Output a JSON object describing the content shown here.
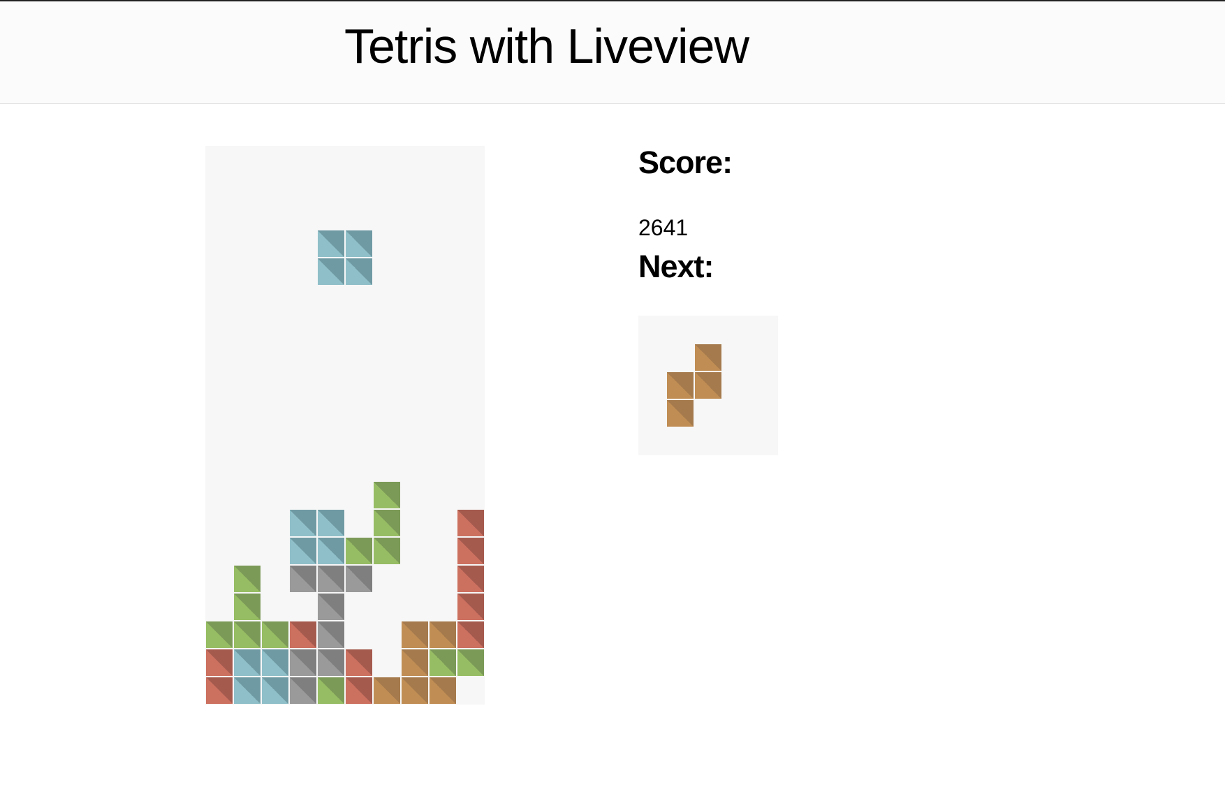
{
  "header": {
    "title": "Tetris with Liveview"
  },
  "sidebar": {
    "score_label": "Score:",
    "score_value": "2641",
    "next_label": "Next:"
  },
  "colors": {
    "blue": [
      "#8fbfc8",
      "#6f9aa3"
    ],
    "green": [
      "#97bd64",
      "#7b9a57"
    ],
    "red": [
      "#cc7060",
      "#a55a4e"
    ],
    "gray": [
      "#9a9a9a",
      "#7f7f7f"
    ],
    "orange": [
      "#c08d54",
      "#a57a4c"
    ],
    "board_bg": "#f7f7f7"
  },
  "board": {
    "columns": 10,
    "rows": 20,
    "active_piece": {
      "shape": "O",
      "color": "blue",
      "cells": [
        [
          4,
          3
        ],
        [
          5,
          3
        ],
        [
          4,
          4
        ],
        [
          5,
          4
        ]
      ]
    },
    "settled_cells": [
      {
        "col": 6,
        "row": 12,
        "color": "green"
      },
      {
        "col": 3,
        "row": 13,
        "color": "blue"
      },
      {
        "col": 4,
        "row": 13,
        "color": "blue"
      },
      {
        "col": 6,
        "row": 13,
        "color": "green"
      },
      {
        "col": 9,
        "row": 13,
        "color": "red"
      },
      {
        "col": 3,
        "row": 14,
        "color": "blue"
      },
      {
        "col": 4,
        "row": 14,
        "color": "blue"
      },
      {
        "col": 5,
        "row": 14,
        "color": "green"
      },
      {
        "col": 6,
        "row": 14,
        "color": "green"
      },
      {
        "col": 9,
        "row": 14,
        "color": "red"
      },
      {
        "col": 1,
        "row": 15,
        "color": "green"
      },
      {
        "col": 3,
        "row": 15,
        "color": "gray"
      },
      {
        "col": 4,
        "row": 15,
        "color": "gray"
      },
      {
        "col": 5,
        "row": 15,
        "color": "gray"
      },
      {
        "col": 9,
        "row": 15,
        "color": "red"
      },
      {
        "col": 1,
        "row": 16,
        "color": "green"
      },
      {
        "col": 4,
        "row": 16,
        "color": "gray"
      },
      {
        "col": 9,
        "row": 16,
        "color": "red"
      },
      {
        "col": 0,
        "row": 17,
        "color": "green"
      },
      {
        "col": 1,
        "row": 17,
        "color": "green"
      },
      {
        "col": 2,
        "row": 17,
        "color": "green"
      },
      {
        "col": 3,
        "row": 17,
        "color": "red"
      },
      {
        "col": 4,
        "row": 17,
        "color": "gray"
      },
      {
        "col": 7,
        "row": 17,
        "color": "orange"
      },
      {
        "col": 8,
        "row": 17,
        "color": "orange"
      },
      {
        "col": 9,
        "row": 17,
        "color": "red"
      },
      {
        "col": 0,
        "row": 18,
        "color": "red"
      },
      {
        "col": 1,
        "row": 18,
        "color": "blue"
      },
      {
        "col": 2,
        "row": 18,
        "color": "blue"
      },
      {
        "col": 3,
        "row": 18,
        "color": "gray"
      },
      {
        "col": 4,
        "row": 18,
        "color": "gray"
      },
      {
        "col": 5,
        "row": 18,
        "color": "red"
      },
      {
        "col": 7,
        "row": 18,
        "color": "orange"
      },
      {
        "col": 8,
        "row": 18,
        "color": "green"
      },
      {
        "col": 9,
        "row": 18,
        "color": "green"
      },
      {
        "col": 0,
        "row": 19,
        "color": "red"
      },
      {
        "col": 1,
        "row": 19,
        "color": "blue"
      },
      {
        "col": 2,
        "row": 19,
        "color": "blue"
      },
      {
        "col": 3,
        "row": 19,
        "color": "gray"
      },
      {
        "col": 4,
        "row": 19,
        "color": "green"
      },
      {
        "col": 5,
        "row": 19,
        "color": "red"
      },
      {
        "col": 6,
        "row": 19,
        "color": "orange"
      },
      {
        "col": 7,
        "row": 19,
        "color": "orange"
      },
      {
        "col": 8,
        "row": 19,
        "color": "orange"
      }
    ]
  },
  "next_piece": {
    "shape": "S",
    "color": "orange",
    "columns": 5,
    "rows": 5,
    "cells": [
      [
        2,
        1
      ],
      [
        1,
        2
      ],
      [
        2,
        2
      ],
      [
        1,
        3
      ]
    ]
  }
}
